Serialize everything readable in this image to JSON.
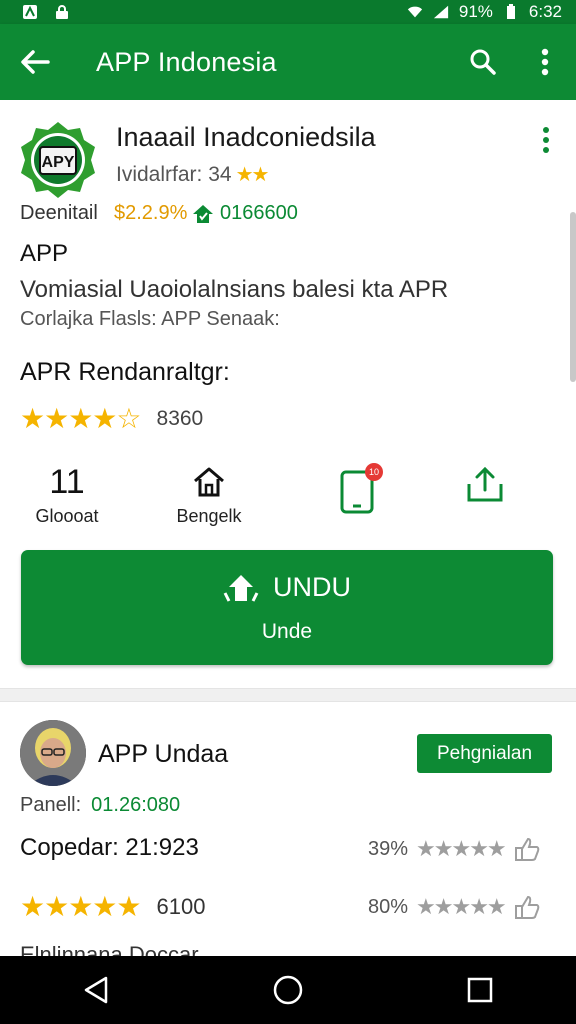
{
  "status_bar": {
    "battery": "91%",
    "time": "6:32"
  },
  "app_bar": {
    "title": "APP Indonesia"
  },
  "app": {
    "name": "Inaaail Inadconiedsila",
    "subtitle": "Ividalrfar: 34",
    "subtitle_stars": "★★",
    "developer_label": "Deenitail",
    "price": "$2.2.9%",
    "downloads": "0166600",
    "line_app": "APP",
    "description": "Vomiasial Uaoiolalnsians balesi kta APR",
    "category": "Corlajka Flasls: APP Senaak:",
    "rent_title": "APR Rendanraltgr:",
    "rating_stars": "★★★★☆",
    "rating_count": "8360"
  },
  "actions": [
    {
      "top": "11",
      "label": "Gloooat"
    },
    {
      "label": "Bengelk"
    }
  ],
  "install": {
    "main_label": "UNDU",
    "sub_label": "Unde"
  },
  "review": {
    "name": "APP Undaa",
    "button_label": "Pehgnialan",
    "meta_label": "Panell:",
    "meta_value": "01.26:080",
    "line": "Copedar: 21:923",
    "stars": "★★★★★",
    "count": "6100",
    "side1_pct": "39%",
    "side2_pct": "80%",
    "side_stars": "★★★★★",
    "cut_text": "Elnlinnana Doccar"
  },
  "colors": {
    "primary": "#0d8a34",
    "status_bar": "#0a7a2d",
    "star": "#f5b400"
  }
}
